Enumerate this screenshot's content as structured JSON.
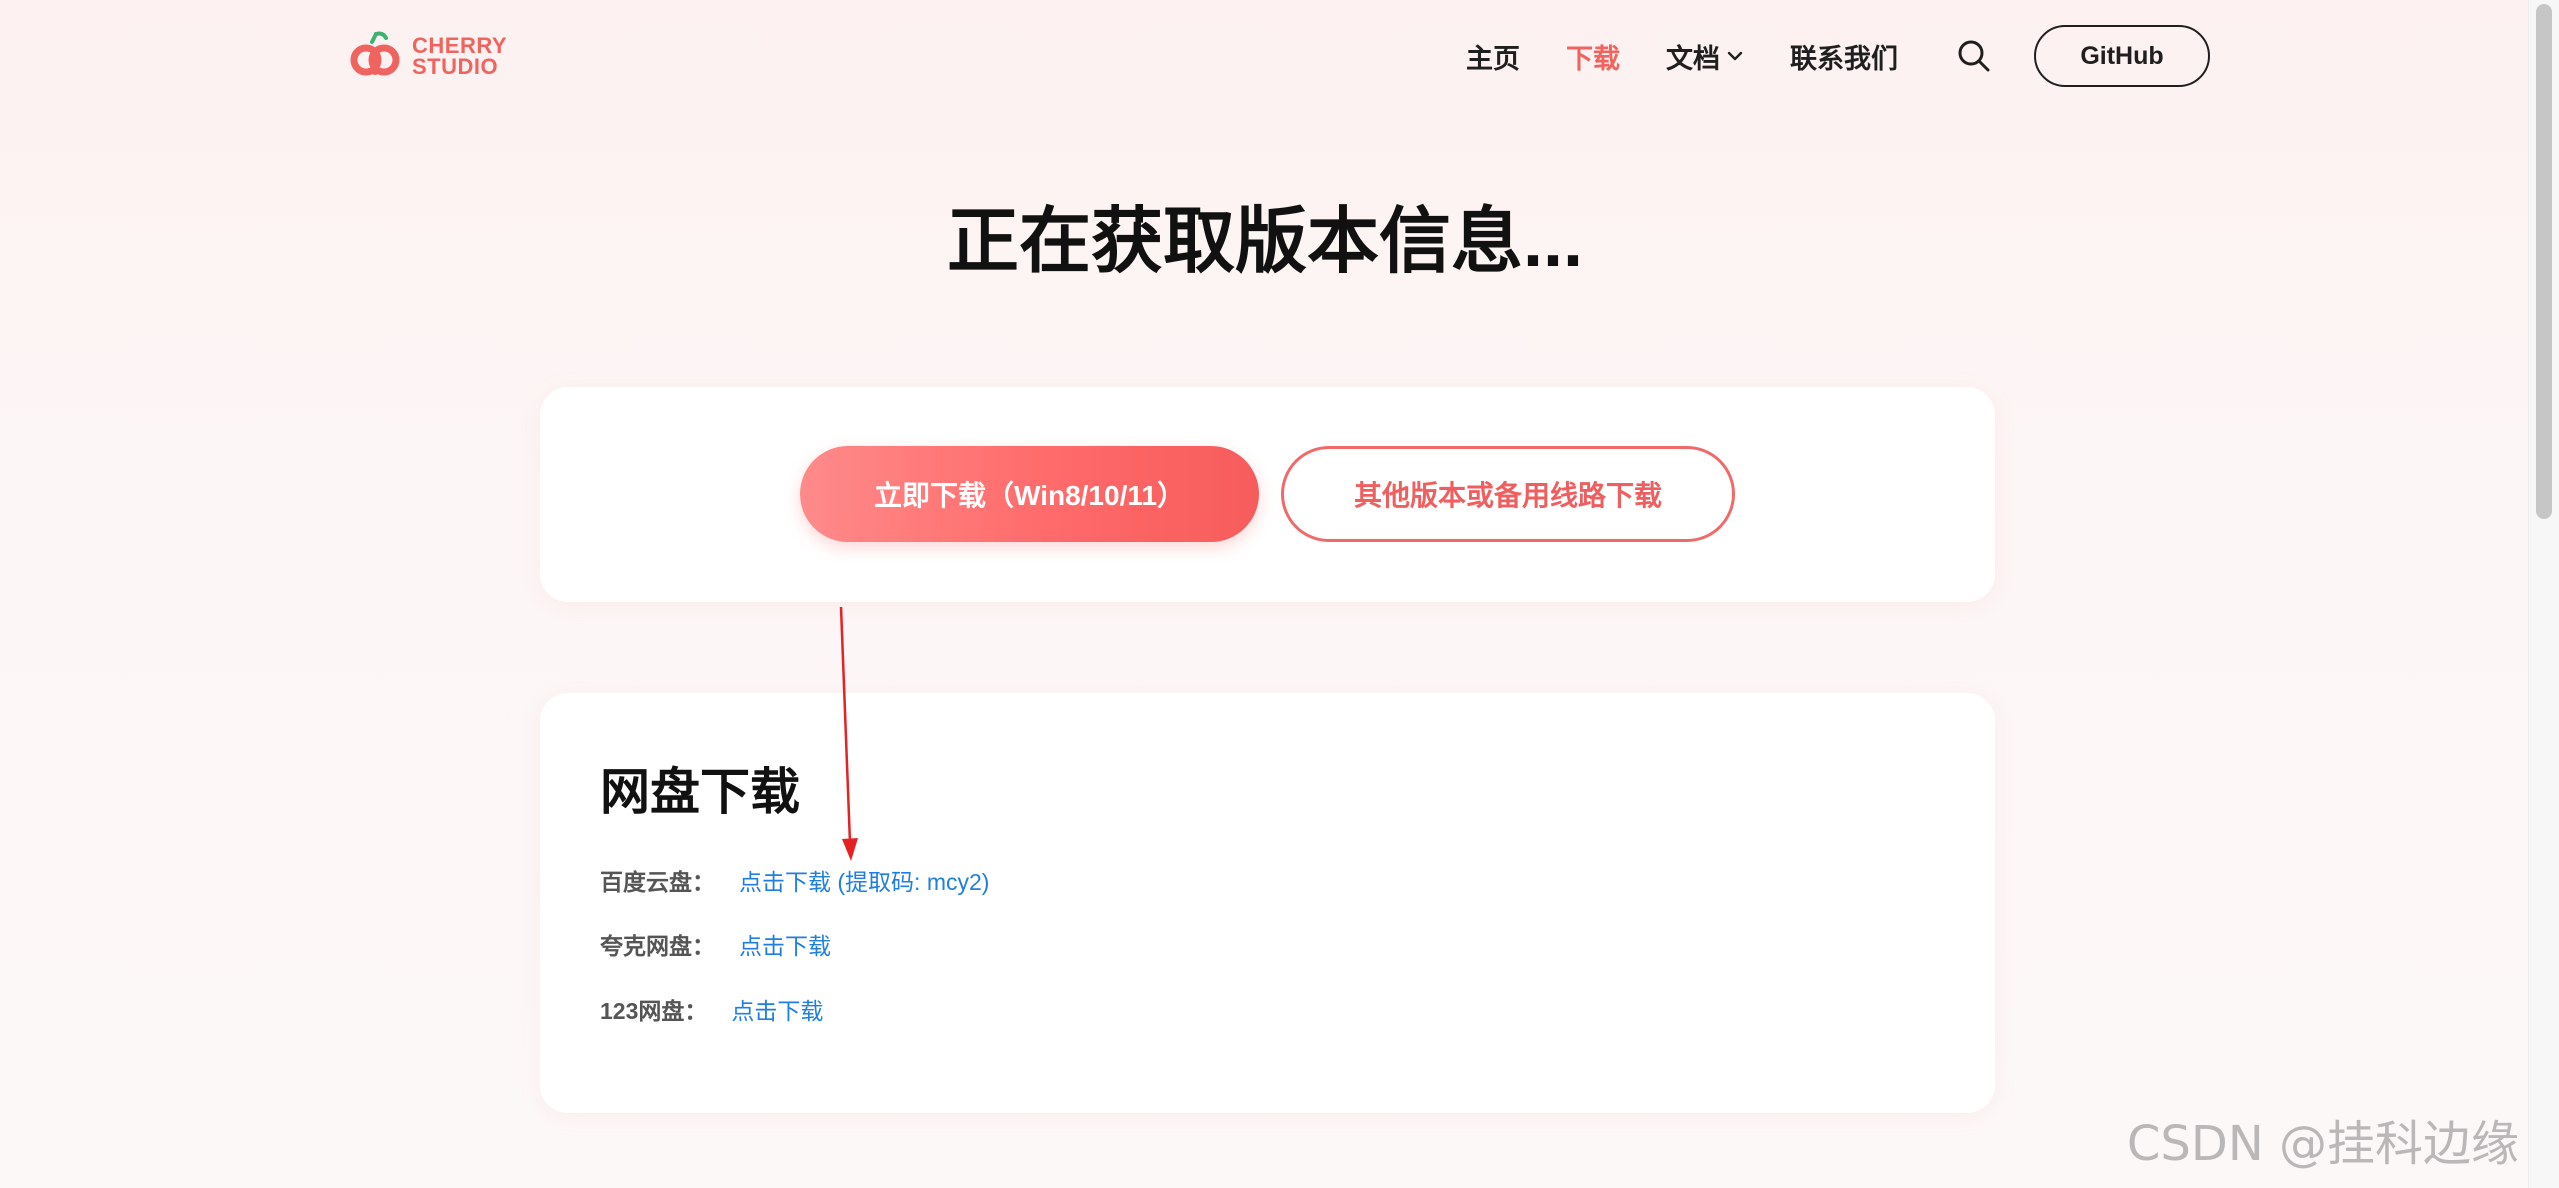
{
  "header": {
    "logo": {
      "line1": "CHERRY",
      "line2": "STUDIO"
    },
    "nav": [
      {
        "label": "主页",
        "active": false
      },
      {
        "label": "下载",
        "active": true
      },
      {
        "label": "文档",
        "active": false,
        "has_dropdown": true
      },
      {
        "label": "联系我们",
        "active": false
      }
    ],
    "search_icon": "search-icon",
    "github_label": "GitHub"
  },
  "main": {
    "title": "正在获取版本信息...",
    "download": {
      "primary_label": "立即下载（Win8/10/11）",
      "secondary_label": "其他版本或备用线路下载"
    },
    "netdisk": {
      "title": "网盘下载",
      "rows": [
        {
          "label": "百度云盘：",
          "link": "点击下载 (提取码: mcy2)"
        },
        {
          "label": "夸克网盘：",
          "link": "点击下载"
        },
        {
          "label": "123网盘：",
          "link": "点击下载"
        }
      ]
    }
  },
  "watermark": "CSDN @挂科边缘",
  "colors": {
    "brand": "#f0645f",
    "link": "#1f7fe0",
    "annotation": "#e52222"
  }
}
